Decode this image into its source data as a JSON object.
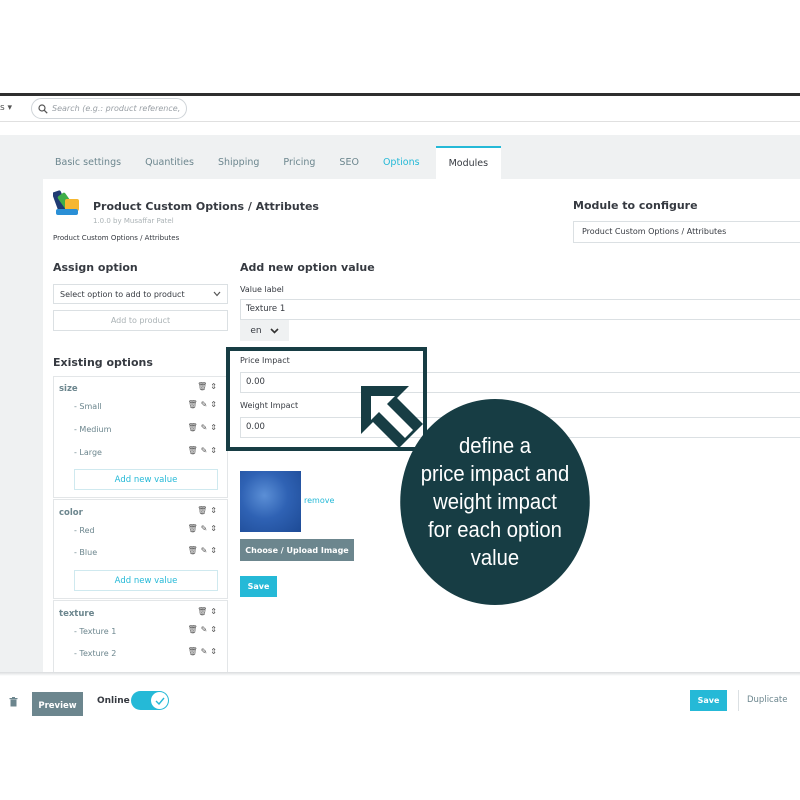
{
  "search": {
    "placeholder": "Search (e.g.: product reference, customer name...)"
  },
  "tabs": [
    {
      "label": "Basic settings"
    },
    {
      "label": "Quantities"
    },
    {
      "label": "Shipping"
    },
    {
      "label": "Pricing"
    },
    {
      "label": "SEO"
    },
    {
      "label": "Options"
    },
    {
      "label": "Modules"
    }
  ],
  "module": {
    "title": "Product Custom Options / Attributes",
    "version": "1.0.0 by Musaffar Patel",
    "subtitle": "Product Custom Options / Attributes"
  },
  "configure": {
    "title": "Module to configure",
    "selected": "Product Custom Options / Attributes"
  },
  "assign": {
    "title": "Assign option",
    "select_label": "Select option to add to product",
    "add_button": "Add to product"
  },
  "existing": {
    "title": "Existing options",
    "add_value_label": "Add new value",
    "groups": [
      {
        "name": "size",
        "values": [
          "- Small",
          "- Medium",
          "- Large"
        ]
      },
      {
        "name": "color",
        "values": [
          "- Red",
          "- Blue"
        ]
      },
      {
        "name": "texture",
        "values": [
          "- Texture 1",
          "- Texture 2"
        ]
      }
    ]
  },
  "form": {
    "title": "Add new option value",
    "value_label": "Value label",
    "value": "Texture 1",
    "lang": "en",
    "price_label": "Price Impact",
    "price_value": "0.00",
    "weight_label": "Weight Impact",
    "weight_value": "0.00",
    "remove": "remove",
    "upload_button": "Choose / Upload Image",
    "save_button": "Save"
  },
  "footer": {
    "preview": "Preview",
    "online": "Online",
    "online_enabled": true,
    "save": "Save",
    "duplicate": "Duplicate"
  },
  "callout": {
    "lines": [
      "define a",
      "price impact and",
      "weight impact",
      "for each option",
      "value"
    ]
  },
  "colors": {
    "accent": "#25b9d7",
    "callout": "#173d44",
    "button_gray": "#6c868e"
  }
}
